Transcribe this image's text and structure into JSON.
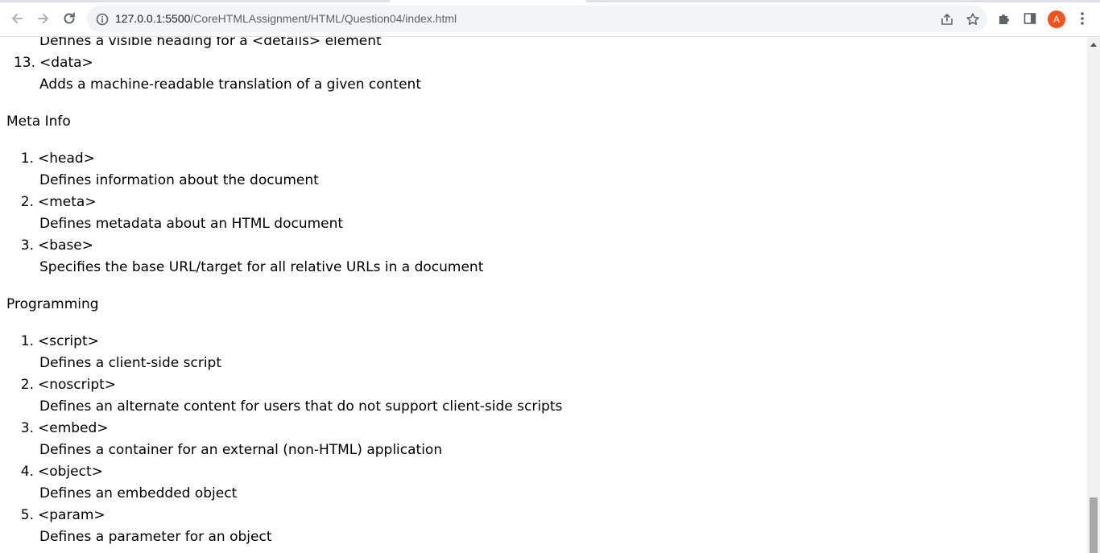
{
  "browser": {
    "url_host": "127.0.0.1:5500",
    "url_path": "/CoreHTMLAssignment/HTML/Question04/index.html",
    "profile_initial": "A",
    "colors": {
      "avatar": "#f4511e",
      "omnibox": "#f1f3f4"
    },
    "icons": [
      "back-arrow-icon",
      "forward-arrow-icon",
      "reload-icon",
      "info-icon",
      "share-icon",
      "star-icon",
      "extensions-icon",
      "side-panel-icon",
      "menu-icon"
    ]
  },
  "page": {
    "partial_item": {
      "description": "Defines a visible heading for a <details> element"
    },
    "prev_list_tail": {
      "number": "13.",
      "tag": "<data>",
      "description": "Adds a machine-readable translation of a given content"
    },
    "sections": [
      {
        "heading": "Meta Info",
        "items": [
          {
            "number": "1.",
            "tag": "<head>",
            "description": "Defines information about the document"
          },
          {
            "number": "2.",
            "tag": "<meta>",
            "description": "Defines metadata about an HTML document"
          },
          {
            "number": "3.",
            "tag": "<base>",
            "description": "Specifies the base URL/target for all relative URLs in a document"
          }
        ]
      },
      {
        "heading": "Programming",
        "items": [
          {
            "number": "1.",
            "tag": "<script>",
            "description": "Defines a client-side script"
          },
          {
            "number": "2.",
            "tag": "<noscript>",
            "description": "Defines an alternate content for users that do not support client-side scripts"
          },
          {
            "number": "3.",
            "tag": "<embed>",
            "description": "Defines a container for an external (non-HTML) application"
          },
          {
            "number": "4.",
            "tag": "<object>",
            "description": "Defines an embedded object"
          },
          {
            "number": "5.",
            "tag": "<param>",
            "description": "Defines a parameter for an object"
          }
        ]
      }
    ]
  }
}
